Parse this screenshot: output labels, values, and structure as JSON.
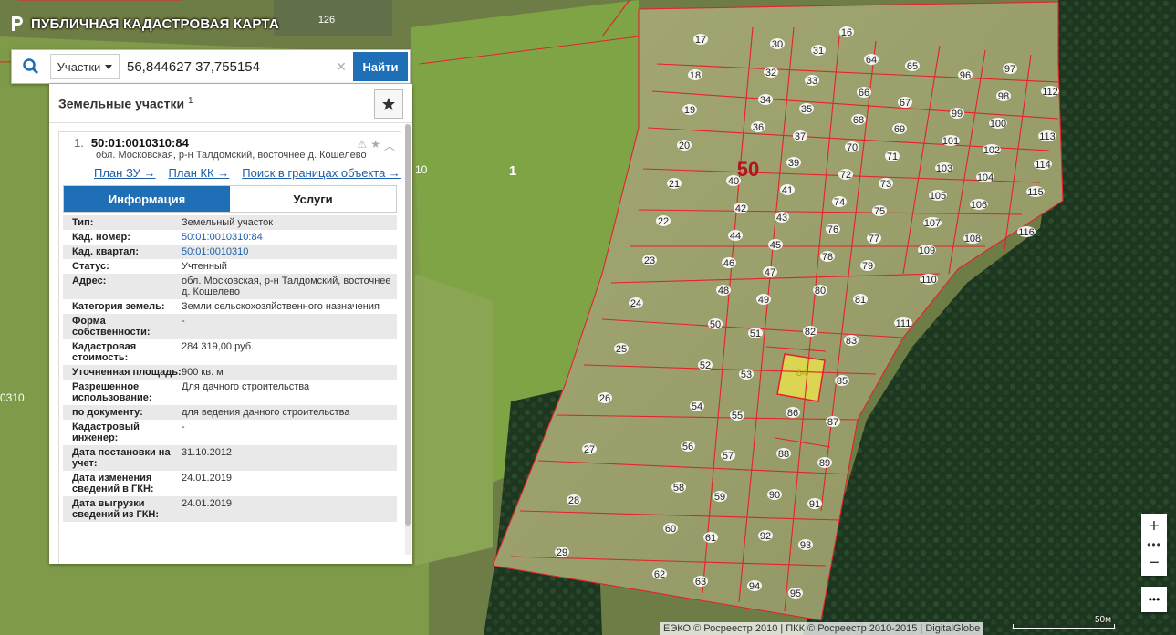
{
  "app": {
    "title": "ПУБЛИЧНАЯ КАДАСТРОВАЯ КАРТА"
  },
  "search": {
    "type_label": "Участки",
    "query": "56,844627 37,755154",
    "button_label": "Найти"
  },
  "panel": {
    "title": "Земельные участки",
    "count": "1"
  },
  "result": {
    "index": "1.",
    "cad_number": "50:01:0010310:84",
    "address": "обл. Московская, р-н Талдомский, восточнее д. Кошелево",
    "links": [
      "План ЗУ →",
      "План КК →",
      "Поиск в границах объекта →"
    ],
    "tabs": [
      "Информация",
      "Услуги"
    ],
    "props": [
      {
        "k": "Тип:",
        "v": "Земельный участок"
      },
      {
        "k": "Кад. номер:",
        "v": "50:01:0010310:84",
        "link": true
      },
      {
        "k": "Кад. квартал:",
        "v": "50:01:0010310",
        "link": true
      },
      {
        "k": "Статус:",
        "v": "Учтенный"
      },
      {
        "k": "Адрес:",
        "v": "обл. Московская, р-н Талдомский, восточнее д. Кошелево"
      },
      {
        "k": "Категория земель:",
        "v": "Земли сельскохозяйственного назначения"
      },
      {
        "k": "Форма собственности:",
        "v": "-"
      },
      {
        "k": "Кадастровая стоимость:",
        "v": "284 319,00 руб."
      },
      {
        "k": "Уточненная площадь:",
        "v": "900 кв. м"
      },
      {
        "k": "Разрешенное использование:",
        "v": "Для дачного строительства"
      },
      {
        "k": "по документу:",
        "v": "для ведения дачного строительства"
      },
      {
        "k": "Кадастровый инженер:",
        "v": "-"
      },
      {
        "k": "Дата постановки на учет:",
        "v": "31.10.2012"
      },
      {
        "k": "Дата изменения сведений в ГКН:",
        "v": "24.01.2019"
      },
      {
        "k": "Дата выгрузки сведений из ГКН:",
        "v": "24.01.2019"
      }
    ]
  },
  "map": {
    "district_label": "50",
    "quarter_label": "1",
    "edge_label_left": "0310",
    "edge_label_mid": "10",
    "top_label": "126",
    "selected_parcel": "84",
    "parcels": [
      "17",
      "18",
      "19",
      "20",
      "21",
      "22",
      "23",
      "24",
      "25",
      "26",
      "27",
      "28",
      "29",
      "30",
      "31",
      "32",
      "33",
      "34",
      "35",
      "36",
      "37",
      "39",
      "40",
      "41",
      "42",
      "43",
      "44",
      "45",
      "46",
      "47",
      "48",
      "49",
      "50",
      "51",
      "52",
      "53",
      "54",
      "55",
      "56",
      "57",
      "58",
      "59",
      "60",
      "61",
      "62",
      "63",
      "64",
      "65",
      "66",
      "67",
      "68",
      "69",
      "70",
      "71",
      "72",
      "73",
      "74",
      "75",
      "76",
      "77",
      "78",
      "79",
      "80",
      "81",
      "82",
      "83",
      "84",
      "85",
      "86",
      "87",
      "88",
      "89",
      "90",
      "91",
      "92",
      "93",
      "94",
      "95",
      "96",
      "97",
      "98",
      "99",
      "100",
      "101",
      "102",
      "103",
      "104",
      "105",
      "106",
      "107",
      "108",
      "109",
      "110",
      "111",
      "112",
      "113",
      "114",
      "115",
      "116",
      "16"
    ],
    "colors": {
      "boundary": "#e4222b",
      "selected_fill": "#f1e84a",
      "field": "#9aa06a",
      "forest": "#1f3a22"
    }
  },
  "controls": {
    "zoom_in": "+",
    "zoom_out": "−",
    "more": "•••"
  },
  "attribution": "ЕЭКО © Росреестр 2010 | ПКК © Росреестр 2010-2015 | DigitalGlobe",
  "scale": "50м"
}
